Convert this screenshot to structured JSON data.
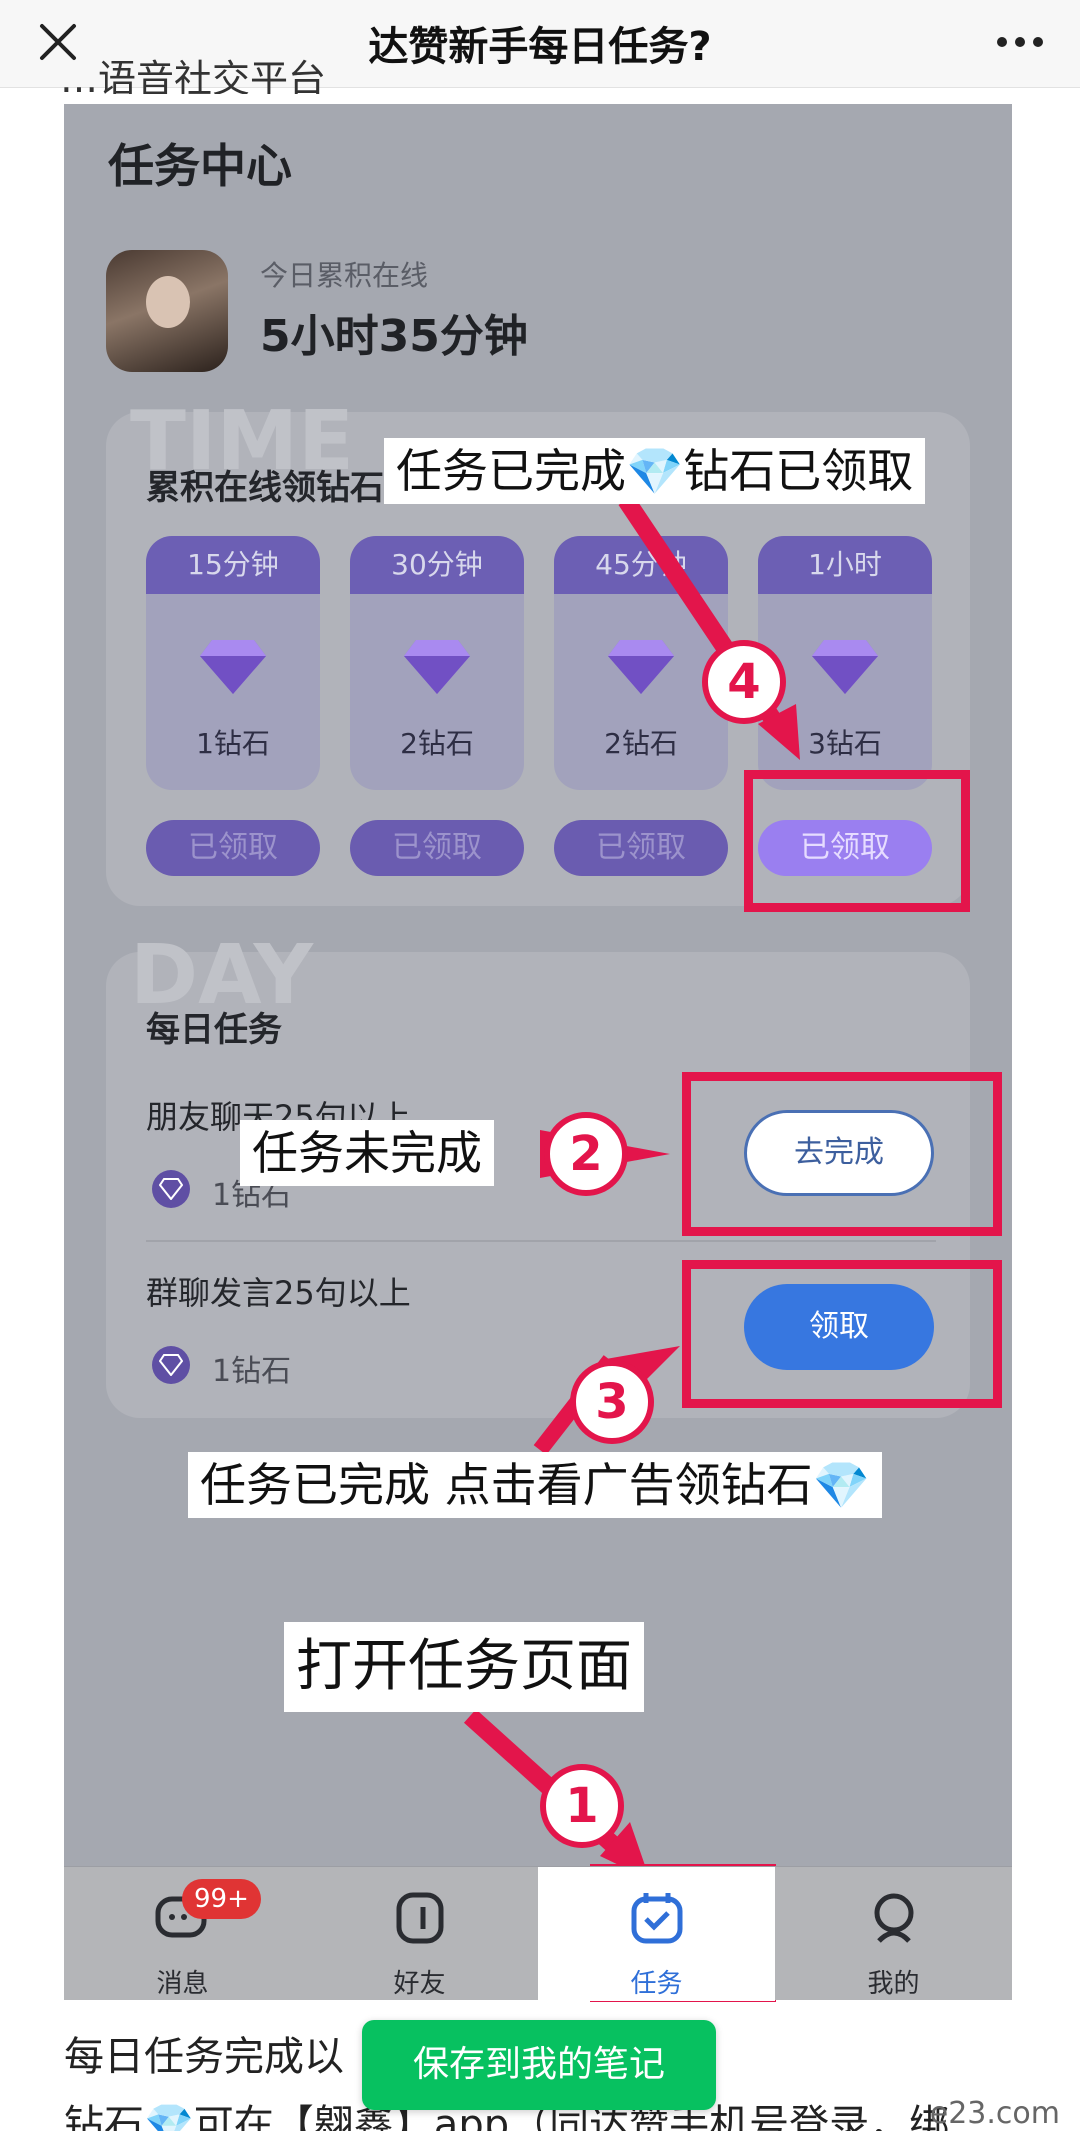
{
  "nav": {
    "title": "达赞新手每日任务?",
    "close_icon": "close-icon",
    "more_icon": "more-icon"
  },
  "article_top_text": "…语音社交平台",
  "screenshot": {
    "header": "任务中心",
    "online": {
      "label": "今日累积在线",
      "value": "5小时35分钟"
    },
    "accum": {
      "watermark": "TIME",
      "title": "累积在线领钻石",
      "rewards": [
        {
          "time": "15分钟",
          "amount": "1钻石",
          "button": "已领取"
        },
        {
          "time": "30分钟",
          "amount": "2钻石",
          "button": "已领取"
        },
        {
          "time": "45分钟",
          "amount": "2钻石",
          "button": "已领取"
        },
        {
          "time": "1小时",
          "amount": "3钻石",
          "button": "已领取"
        }
      ]
    },
    "daily": {
      "watermark": "DAY",
      "title": "每日任务",
      "tasks": [
        {
          "name": "朋友聊天25句以上",
          "reward": "1钻石",
          "button": "去完成"
        },
        {
          "name": "群聊发言25句以上",
          "reward": "1钻石",
          "button": "领取"
        }
      ]
    },
    "annotations": {
      "a4": "任务已完成💎钻石已领取",
      "a2": "任务未完成",
      "a3": "任务已完成 点击看广告领钻石💎",
      "a1": "打开任务页面"
    },
    "numbers": [
      "1",
      "2",
      "3",
      "4"
    ],
    "tabs": [
      {
        "label": "消息",
        "icon": "message-icon",
        "badge": "99+"
      },
      {
        "label": "好友",
        "icon": "friends-icon"
      },
      {
        "label": "任务",
        "icon": "task-icon"
      },
      {
        "label": "我的",
        "icon": "profile-icon"
      }
    ]
  },
  "below": {
    "line1": "每日任务完成以",
    "line2": "钻石💎可在【翱鑫】app（同达赞手机号登录，绑",
    "save_button": "保存到我的笔记",
    "site_watermark": "e23.com"
  },
  "colors": {
    "accent_red": "#e3154b",
    "accent_blue": "#3777e0",
    "accent_green": "#07c160",
    "purple": "#6c5fb4"
  }
}
